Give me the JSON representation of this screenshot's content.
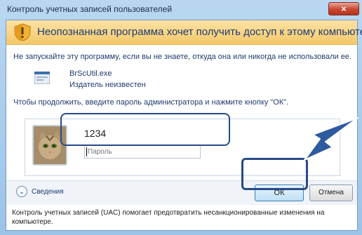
{
  "window": {
    "title": "Контроль учетных записей пользователей",
    "close_label": "×"
  },
  "banner": {
    "text": "Неопознанная программа хочет получить доступ к этому компьютеру"
  },
  "warning_text": "Не запускайте эту программу, если вы не знаете, откуда она или никогда не использовали ее.",
  "program": {
    "name": "BrScUtil.exe",
    "publisher": "Издатель неизвестен"
  },
  "instruction": "Чтобы продолжить, введите пароль администратора и нажмите кнопку \"ОК\".",
  "credentials": {
    "username": "1234",
    "password_placeholder": "Пароль"
  },
  "footer": {
    "details_label": "Сведения",
    "ok_label": "ОК",
    "cancel_label": "Отмена",
    "uac_note": "Контроль учетных записей (UAC) помогает предотвратить несанкционированные изменения на компьютере."
  },
  "colors": {
    "accent": "#274b86",
    "banner": "#f3c86a"
  },
  "icons": {
    "shield": "uac-shield-icon",
    "app": "app-icon",
    "chevron": "chevron-down-icon",
    "arrow": "pointer-arrow-icon"
  }
}
